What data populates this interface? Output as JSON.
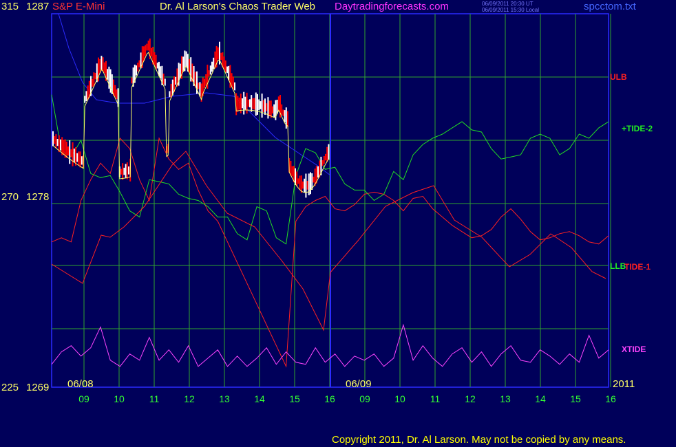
{
  "header": {
    "ticker_left": "315",
    "price_top": "1287",
    "instrument": "S&P E-Mini",
    "title": "Dr. Al Larson's Chaos Trader Web",
    "site": "Daytradingforecasts.com",
    "timestamp_ut": "06/09/2011 20:30 UT",
    "timestamp_local": "06/09/2011 15:30 Local",
    "filename": "spcctom.txt"
  },
  "y_axis": {
    "mid_left": "270",
    "mid_price": "1278",
    "bottom_left": "225",
    "bottom_price": "1269"
  },
  "labels": {
    "ulb": "ULB",
    "tide2": "+TIDE-2",
    "llb": "LLB",
    "tide1": "TIDE-1",
    "xtide": "XTIDE"
  },
  "dates": {
    "day1": "06/08",
    "day2": "06/09",
    "year": "2011"
  },
  "copyright": "Copyright 2011, Dr. Al Larson. May not be copied by any means.",
  "colors": {
    "background": "#00005a",
    "grid": "#2fa52f",
    "price_up": "#ffffff",
    "price_down": "#ff0000",
    "moving_avg": "#ffff66",
    "blue_line": "#2b2bff",
    "ulb_line": "#ff2020",
    "tide2_line": "#22dd22",
    "xtide_line": "#ff44ff",
    "axis_labels": "#33ff33"
  },
  "chart_data": {
    "type": "line",
    "title": "S&P E-Mini",
    "x_tick_labels": [
      "09",
      "10",
      "11",
      "12",
      "13",
      "14",
      "15",
      "16",
      "09",
      "10",
      "11",
      "12",
      "13",
      "14",
      "15",
      "16"
    ],
    "y_ticks": [
      {
        "left": "315",
        "price": "1287"
      },
      {
        "left": "270",
        "price": "1278"
      },
      {
        "left": "225",
        "price": "1269"
      }
    ],
    "series": [
      {
        "name": "ULB",
        "color": "#ff2020",
        "points": [
          [
            0,
            1276
          ],
          [
            1,
            1276.2
          ],
          [
            2,
            1276
          ],
          [
            3,
            1278
          ],
          [
            4,
            1279
          ],
          [
            5,
            1279.8
          ],
          [
            6,
            1279.3
          ],
          [
            7,
            1281
          ],
          [
            8,
            1280.5
          ],
          [
            9,
            1279
          ],
          [
            10,
            1278
          ],
          [
            11,
            1281
          ],
          [
            12,
            1280
          ],
          [
            13,
            1279.5
          ],
          [
            14,
            1279.8
          ],
          [
            15,
            1278.5
          ],
          [
            16,
            1277.5
          ],
          [
            17,
            1277
          ],
          [
            18,
            1276
          ],
          [
            19,
            1275
          ],
          [
            20,
            1274
          ],
          [
            21,
            1273
          ],
          [
            22,
            1272
          ],
          [
            23,
            1271
          ],
          [
            24,
            1270
          ],
          [
            25,
            1277
          ],
          [
            26,
            1277.7
          ],
          [
            27,
            1278
          ],
          [
            28,
            1278.2
          ],
          [
            29,
            1277.6
          ],
          [
            30,
            1277.5
          ],
          [
            31,
            1277.8
          ],
          [
            32,
            1278.3
          ],
          [
            33,
            1278.4
          ],
          [
            34,
            1278.3
          ],
          [
            35,
            1278
          ],
          [
            36,
            1277.5
          ],
          [
            37,
            1278.1
          ],
          [
            38,
            1278.2
          ],
          [
            39,
            1277.6
          ],
          [
            40,
            1277.2
          ],
          [
            41,
            1276.8
          ],
          [
            42,
            1276.5
          ],
          [
            43,
            1276.2
          ],
          [
            44,
            1276.3
          ],
          [
            45,
            1276.6
          ],
          [
            46,
            1277.2
          ],
          [
            47,
            1277.6
          ],
          [
            48,
            1277.1
          ],
          [
            49,
            1276.5
          ],
          [
            50,
            1276.1
          ],
          [
            51,
            1276.2
          ],
          [
            52,
            1276.4
          ],
          [
            53,
            1276.5
          ],
          [
            54,
            1276.3
          ],
          [
            55,
            1276.0
          ],
          [
            56,
            1275.9
          ],
          [
            57,
            1276.3
          ]
        ]
      },
      {
        "name": "+TIDE-2",
        "color": "#22dd22",
        "points": [
          [
            0,
            1283.1
          ],
          [
            1,
            1280.4
          ],
          [
            2,
            1280.1
          ],
          [
            3,
            1280.9
          ],
          [
            4,
            1279.3
          ],
          [
            5,
            1279.1
          ],
          [
            6,
            1279.2
          ],
          [
            7,
            1278.4
          ],
          [
            8,
            1277.5
          ],
          [
            9,
            1277.2
          ],
          [
            10,
            1279.0
          ],
          [
            11,
            1278.9
          ],
          [
            12,
            1278.8
          ],
          [
            13,
            1278.3
          ],
          [
            14,
            1278.1
          ],
          [
            15,
            1278.0
          ],
          [
            16,
            1277.7
          ],
          [
            17,
            1277.2
          ],
          [
            18,
            1277.2
          ],
          [
            19,
            1276.4
          ],
          [
            20,
            1276.1
          ],
          [
            21,
            1277.7
          ],
          [
            22,
            1277.5
          ],
          [
            23,
            1276.2
          ],
          [
            24,
            1275.9
          ],
          [
            25,
            1279.2
          ],
          [
            26,
            1280.5
          ],
          [
            27,
            1280.3
          ],
          [
            28,
            1279.5
          ],
          [
            29,
            1279.6
          ],
          [
            30,
            1278.8
          ],
          [
            31,
            1278.5
          ],
          [
            32,
            1278.5
          ],
          [
            33,
            1278.0
          ],
          [
            34,
            1278.3
          ],
          [
            35,
            1279.4
          ],
          [
            36,
            1279.0
          ],
          [
            37,
            1280.2
          ],
          [
            38,
            1280.7
          ],
          [
            39,
            1281.0
          ],
          [
            40,
            1281.2
          ],
          [
            41,
            1281.5
          ],
          [
            42,
            1281.8
          ],
          [
            43,
            1281.4
          ],
          [
            44,
            1281.3
          ],
          [
            45,
            1280.5
          ],
          [
            46,
            1280.0
          ],
          [
            47,
            1280.1
          ],
          [
            48,
            1280.2
          ],
          [
            49,
            1281.0
          ],
          [
            50,
            1281.2
          ],
          [
            51,
            1281.0
          ],
          [
            52,
            1280.2
          ],
          [
            53,
            1280.5
          ],
          [
            54,
            1281.2
          ],
          [
            55,
            1281.0
          ],
          [
            56,
            1281.5
          ],
          [
            57,
            1281.8
          ]
        ]
      },
      {
        "name": "XTIDE",
        "color": "#ff44ff",
        "points": [
          [
            0,
            1270.1
          ],
          [
            1,
            1270.7
          ],
          [
            2,
            1271.0
          ],
          [
            3,
            1270.5
          ],
          [
            4,
            1270.9
          ],
          [
            5,
            1271.9
          ],
          [
            6,
            1270.3
          ],
          [
            7,
            1270.0
          ],
          [
            8,
            1270.6
          ],
          [
            9,
            1270.3
          ],
          [
            10,
            1271.4
          ],
          [
            11,
            1270.3
          ],
          [
            12,
            1270.8
          ],
          [
            13,
            1270.2
          ],
          [
            14,
            1271.0
          ],
          [
            15,
            1270.0
          ],
          [
            16,
            1270.4
          ],
          [
            17,
            1270.8
          ],
          [
            18,
            1270.0
          ],
          [
            19,
            1270.5
          ],
          [
            20,
            1270.0
          ],
          [
            21,
            1270.4
          ],
          [
            22,
            1270.9
          ],
          [
            23,
            1270.1
          ],
          [
            24,
            1270.7
          ],
          [
            25,
            1270.2
          ],
          [
            26,
            1270.1
          ],
          [
            27,
            1270.9
          ],
          [
            28,
            1270.2
          ],
          [
            29,
            1270.6
          ],
          [
            30,
            1270.0
          ],
          [
            31,
            1270.5
          ],
          [
            32,
            1270.3
          ],
          [
            33,
            1270.6
          ],
          [
            34,
            1270.0
          ],
          [
            35,
            1270.4
          ],
          [
            36,
            1272.0
          ],
          [
            37,
            1270.3
          ],
          [
            38,
            1271.0
          ],
          [
            39,
            1270.4
          ],
          [
            40,
            1270.0
          ],
          [
            41,
            1270.6
          ],
          [
            42,
            1270.9
          ],
          [
            43,
            1270.2
          ],
          [
            44,
            1270.7
          ],
          [
            45,
            1270.0
          ],
          [
            46,
            1270.6
          ],
          [
            47,
            1271.0
          ],
          [
            48,
            1270.3
          ],
          [
            49,
            1270.2
          ],
          [
            50,
            1270.8
          ],
          [
            51,
            1270.5
          ],
          [
            52,
            1270.1
          ],
          [
            53,
            1270.6
          ],
          [
            54,
            1270.2
          ],
          [
            55,
            1271.5
          ],
          [
            56,
            1270.4
          ],
          [
            57,
            1270.8
          ]
        ]
      }
    ]
  }
}
